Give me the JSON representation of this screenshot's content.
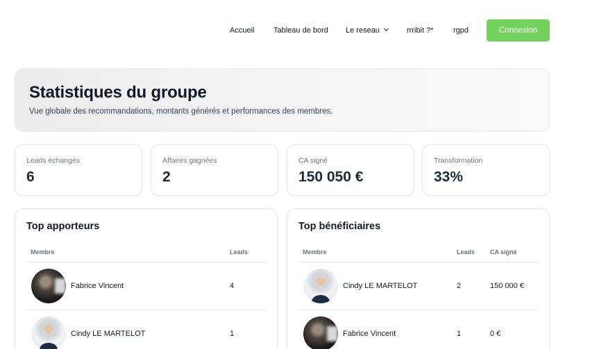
{
  "nav": {
    "items": [
      "Accueil",
      "Tableau de bord",
      "Le reseau",
      "rrribit ?*",
      "rgpd"
    ],
    "connexion": "Connexion",
    "accent": "#74d25e"
  },
  "hero": {
    "title": "Statistiques du groupe",
    "subtitle": "Vue globale des recommandations, montants générés et performances des membres."
  },
  "stats": [
    {
      "label": "Leads échangés",
      "value": "6"
    },
    {
      "label": "Affaires gagnées",
      "value": "2"
    },
    {
      "label": "CA signé",
      "value": "150 050 €"
    },
    {
      "label": "Transformation",
      "value": "33%"
    }
  ],
  "top_apporteurs": {
    "title": "Top apporteurs",
    "columns": [
      "Membre",
      "Leads"
    ],
    "rows": [
      {
        "name": "Fabrice Vincent",
        "leads": "4"
      },
      {
        "name": "Cindy LE MARTELOT",
        "leads": "1"
      }
    ]
  },
  "top_beneficiaires": {
    "title": "Top bénéficiaires",
    "columns": [
      "Membre",
      "Leads",
      "CA signé"
    ],
    "rows": [
      {
        "name": "Cindy LE MARTELOT",
        "leads": "2",
        "ca": "150 000 €"
      },
      {
        "name": "Fabrice Vincent",
        "leads": "1",
        "ca": "0 €"
      }
    ]
  }
}
